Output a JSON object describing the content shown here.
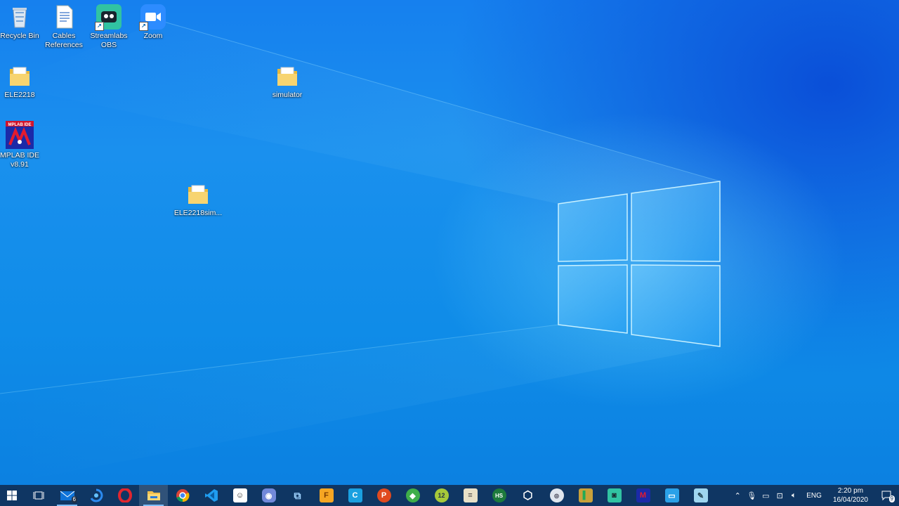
{
  "desktop_icons": [
    {
      "id": "recycle-bin",
      "label": "Recycle Bin",
      "icon": "recycle-bin-icon"
    },
    {
      "id": "cables",
      "label": "Cables References",
      "icon": "document-icon"
    },
    {
      "id": "streamlabs",
      "label": "Streamlabs OBS",
      "icon": "streamlabs-icon"
    },
    {
      "id": "zoom",
      "label": "Zoom",
      "icon": "zoom-icon"
    },
    {
      "id": "ele2218",
      "label": "ELE2218",
      "icon": "folder-icon"
    },
    {
      "id": "simulator",
      "label": "simulator",
      "icon": "folder-icon"
    },
    {
      "id": "mplab",
      "label": "MPLAB IDE v8.91",
      "icon": "mplab-icon"
    },
    {
      "id": "ele2218sim",
      "label": "ELE2218sim...",
      "icon": "folder-icon"
    }
  ],
  "taskbar": {
    "apps": [
      {
        "name": "start-button",
        "icon": "windows-icon"
      },
      {
        "name": "task-view",
        "icon": "task-view-icon"
      },
      {
        "name": "mail",
        "icon": "mail-icon",
        "badge": "6"
      },
      {
        "name": "app-blue",
        "icon": "sync-icon"
      },
      {
        "name": "opera",
        "icon": "opera-icon"
      },
      {
        "name": "file-explorer",
        "icon": "folder-icon"
      },
      {
        "name": "chrome",
        "icon": "chrome-icon"
      },
      {
        "name": "vscode",
        "icon": "vscode-icon"
      },
      {
        "name": "app-chat",
        "icon": "chat-icon"
      },
      {
        "name": "discord",
        "icon": "discord-icon"
      },
      {
        "name": "network-app",
        "icon": "network-icon"
      },
      {
        "name": "app-f",
        "icon": "f-icon"
      },
      {
        "name": "app-c",
        "icon": "c-icon"
      },
      {
        "name": "app-p",
        "icon": "p-icon"
      },
      {
        "name": "app-green",
        "icon": "green-app-icon"
      },
      {
        "name": "app-12",
        "icon": "twelve-icon"
      },
      {
        "name": "app-doc",
        "icon": "document-icon"
      },
      {
        "name": "app-hs",
        "icon": "hs-icon"
      },
      {
        "name": "virtualbox",
        "icon": "cube-icon"
      },
      {
        "name": "app-circle",
        "icon": "circle-app-icon"
      },
      {
        "name": "app-book",
        "icon": "book-icon"
      },
      {
        "name": "streamlabs",
        "icon": "streamlabs-icon"
      },
      {
        "name": "mplab",
        "icon": "mplab-icon"
      },
      {
        "name": "app-monitor",
        "icon": "monitor-icon"
      },
      {
        "name": "app-pen",
        "icon": "pen-icon"
      }
    ],
    "mail_badge": "6",
    "language": "ENG",
    "time": "2:20 pm",
    "date": "16/04/2020",
    "notification_count": "9"
  },
  "colors": {
    "desktop": "#1a8cee",
    "taskbar": "#103058",
    "accent": "#7fbfff"
  }
}
